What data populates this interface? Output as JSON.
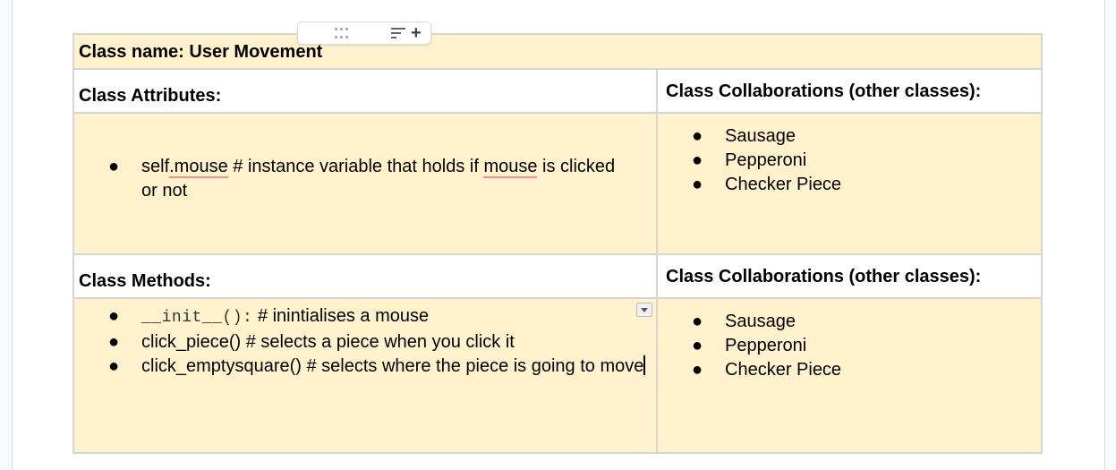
{
  "table": {
    "class_name": "Class name:  User Movement",
    "attributes_header": "Class Attributes:",
    "collab_header_1": "Class Collaborations (other classes):",
    "attributes": {
      "prefix": "self",
      "word1": ".mouse",
      "mid": " # instance variable that holds if ",
      "word2": "mouse",
      "suffix": " is clicked or not"
    },
    "collaborations_1": [
      "Sausage",
      "Pepperoni",
      "Checker Piece"
    ],
    "methods_header": "Class Methods:",
    "collab_header_2": "Class Collaborations (other classes):",
    "methods": {
      "m1_code": "__init__():",
      "m1_comment": " # inintialises a mouse",
      "m2": "click_piece()  # selects a piece when you click it",
      "m3": "click_emptysquare() # selects where the piece is going to move"
    },
    "collaborations_2": [
      "Sausage",
      "Pepperoni",
      "Checker Piece"
    ]
  },
  "bullet": "●",
  "toolbar": {
    "drag": "drag-handle-icon",
    "sort": "sort-icon",
    "plus": "+"
  },
  "colors": {
    "cell_yellow": "#fff2cc",
    "border": "#d5d5d5",
    "spell_underline": "#f28b9b"
  }
}
